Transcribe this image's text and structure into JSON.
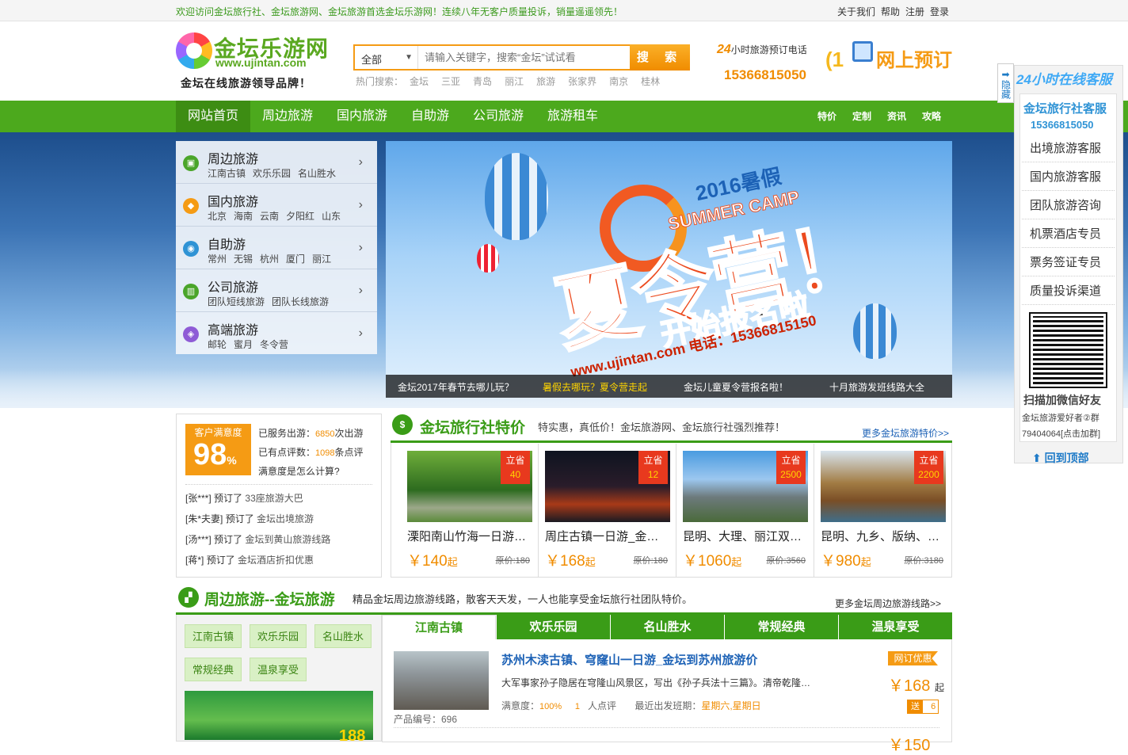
{
  "topbar": {
    "welcome": "欢迎访问金坛旅行社、金坛旅游网、金坛旅游首选金坛乐游网！连续八年无客户质量投诉，销量遥遥领先！",
    "links": [
      "关于我们",
      "帮助",
      "注册",
      "登录"
    ]
  },
  "header": {
    "logo_cn": "金坛乐游网",
    "logo_url": "www.ujintan.com",
    "slogan": "金坛在线旅游领导品牌！",
    "search": {
      "category": "全部",
      "placeholder": "请输入关键字，搜索“金坛”试试看",
      "button": "搜 索",
      "hot_label": "热门搜索：",
      "hot": [
        "金坛",
        "三亚",
        "青岛",
        "丽江",
        "旅游",
        "张家界",
        "南京",
        "桂林"
      ]
    },
    "phone_hours": "24",
    "phone_label": "小时旅游预订电话",
    "phone": "15366815050",
    "online_label": "网上预订"
  },
  "nav": {
    "main": [
      "网站首页",
      "周边旅游",
      "国内旅游",
      "自助游",
      "公司旅游",
      "旅游租车"
    ],
    "right": [
      "特价",
      "定制",
      "资讯",
      "攻略"
    ]
  },
  "side_menu": [
    {
      "title": "周边旅游",
      "subs": [
        "江南古镇",
        "欢乐乐园",
        "名山胜水"
      ],
      "color": "#4aa52a"
    },
    {
      "title": "国内旅游",
      "subs": [
        "北京",
        "海南",
        "云南",
        "夕阳红",
        "山东"
      ],
      "color": "#f59b14"
    },
    {
      "title": "自助游",
      "subs": [
        "常州",
        "无锡",
        "杭州",
        "厦门",
        "丽江"
      ],
      "color": "#2f93d5"
    },
    {
      "title": "公司旅游",
      "subs": [
        "团队短线旅游",
        "团队长线旅游"
      ],
      "color": "#4aa52a"
    },
    {
      "title": "高端旅游",
      "subs": [
        "邮轮",
        "蜜月",
        "冬令营"
      ],
      "color": "#8e5bd6"
    }
  ],
  "slide": {
    "year": "2016暑假",
    "camp": "SUMMER CAMP",
    "headline": "夏令营！",
    "sub": "开始报名啦",
    "url": "www.ujintan.com 电话：15366815150",
    "captions": [
      "金坛2017年春节去哪儿玩？",
      "暑假去哪玩？夏令营走起",
      "金坛儿童夏令营报名啦！",
      "十月旅游发班线路大全"
    ],
    "active_caption": 1
  },
  "service": {
    "hide": "隐藏",
    "title": "24小时在线客服",
    "company": "金坛旅行社客服",
    "tel": "15366815050",
    "items": [
      "出境旅游客服",
      "国内旅游客服",
      "团队旅游咨询",
      "机票酒店专员",
      "票务签证专员",
      "质量投诉渠道"
    ],
    "qr_text": "扫描加微信好友",
    "group_line1": "金坛旅游爱好者②群",
    "group_line2": "79404064[点击加群]",
    "back_top": "回到顶部"
  },
  "satisfaction": {
    "label": "客户满意度",
    "value": "98",
    "unit": "%",
    "served_pre": "已服务出游：",
    "served": "6850",
    "served_post": "次出游",
    "reviews_pre": "已有点评数：",
    "reviews": "1098",
    "reviews_post": "条点评",
    "how": "满意度是怎么计算?",
    "bookings": [
      {
        "name": "[张***]",
        "verb": "预订了",
        "what": "33座旅游大巴"
      },
      {
        "name": "[朱*夫妻]",
        "verb": "预订了",
        "what": "金坛出境旅游"
      },
      {
        "name": "[汤***]",
        "verb": "预订了",
        "what": "金坛到黄山旅游线路"
      },
      {
        "name": "[蒋*]",
        "verb": "预订了",
        "what": "金坛酒店折扣优惠"
      }
    ]
  },
  "specials": {
    "title": "金坛旅行社特价",
    "subtitle": "特实惠，真低价！金坛旅游网、金坛旅行社强烈推荐！",
    "more": "更多金坛旅游特价>>",
    "save_label": "立省",
    "items": [
      {
        "name": "溧阳南山竹海一日游_金坛",
        "price": "￥140",
        "unit": "起",
        "orig": "原价:180",
        "save": "40"
      },
      {
        "name": "周庄古镇一日游_金坛到周庄",
        "price": "￥168",
        "unit": "起",
        "orig": "原价:180",
        "save": "12"
      },
      {
        "name": "昆明、大理、丽江双飞六日游",
        "price": "￥1060",
        "unit": "起",
        "orig": "原价:3560",
        "save": "2500"
      },
      {
        "name": "昆明、九乡、版纳、大理游",
        "price": "￥980",
        "unit": "起",
        "orig": "原价:3180",
        "save": "2200"
      }
    ]
  },
  "nearby": {
    "title": "周边旅游--金坛旅游",
    "subtitle": "精品金坛周边旅游线路，散客天天发，一人也能享受金坛旅行社团队特价。",
    "more": "更多金坛周边旅游线路>>",
    "chips": [
      "江南古镇",
      "欢乐乐园",
      "名山胜水",
      "常规经典",
      "温泉享受"
    ],
    "photo_price": "188",
    "tabs": [
      "江南古镇",
      "欢乐乐园",
      "名山胜水",
      "常规经典",
      "温泉享受"
    ],
    "product": {
      "name": "苏州木渎古镇、穹窿山一日游_金坛到苏州旅游价",
      "desc": "大军事家孙子隐居在穹隆山风景区，写出《孙子兵法十三篇》。清帝乾隆…",
      "sat_label": "满意度：",
      "sat": "100%",
      "reviews": "1",
      "reviews_label": "人点评",
      "depart_label": "最近出发班期：",
      "depart": "星期六,星期日",
      "code": "产品编号：696",
      "badge": "网订优惠",
      "price": "￥168",
      "unit": "起",
      "gift_label": "送",
      "gift": "6"
    },
    "next_price": "￥150"
  }
}
